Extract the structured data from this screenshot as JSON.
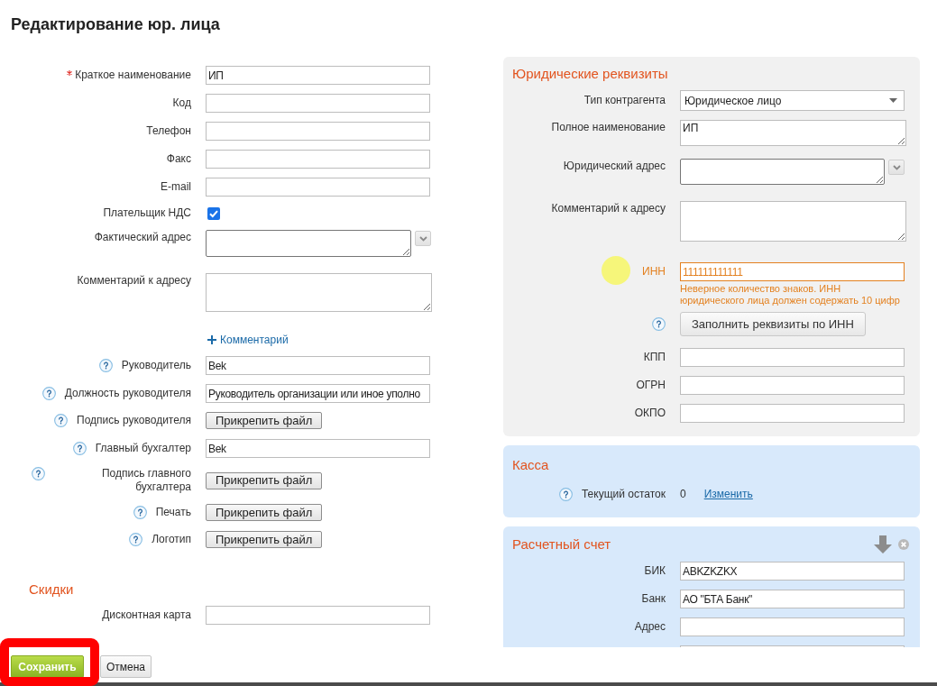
{
  "title": "Редактирование юр. лица",
  "main_form": {
    "rows": [
      {
        "label": "Краткое наименование",
        "kind": "input",
        "value": "ИП",
        "required": true,
        "help": false
      },
      {
        "label": "Код",
        "kind": "input",
        "required": false,
        "help": false
      },
      {
        "label": "Телефон",
        "kind": "input",
        "required": false,
        "help": false
      },
      {
        "label": "Факс",
        "kind": "input",
        "required": false,
        "help": false
      },
      {
        "label": "E-mail",
        "kind": "input",
        "required": false,
        "help": false
      },
      {
        "label": "Плательщик НДС",
        "kind": "checkbox",
        "checked": true,
        "required": false,
        "help": false
      },
      {
        "label": "Фактический адрес",
        "kind": "address",
        "required": false,
        "help": false
      },
      {
        "label": "Комментарий к адресу",
        "kind": "textarea",
        "required": false,
        "help": false
      },
      {
        "kind": "link",
        "text": "Комментарий"
      },
      {
        "label": "Руководитель",
        "kind": "input",
        "value": "Bek",
        "required": false,
        "help": true
      },
      {
        "label": "Должность руководителя",
        "kind": "input",
        "value": "Руководитель организации или иное уполно",
        "required": false,
        "help": true
      },
      {
        "label": "Подпись руководителя",
        "kind": "file",
        "button": "Прикрепить файл",
        "required": false,
        "help": true
      },
      {
        "label": "Главный бухгалтер",
        "kind": "input",
        "value": "Bek",
        "required": false,
        "help": true
      },
      {
        "label": "Подпись главного бухгалтера",
        "kind": "file",
        "button": "Прикрепить файл",
        "required": false,
        "help": true
      },
      {
        "label": "Печать",
        "kind": "file",
        "button": "Прикрепить файл",
        "required": false,
        "help": true
      },
      {
        "label": "Логотип",
        "kind": "file",
        "button": "Прикрепить файл",
        "required": false,
        "help": true
      }
    ]
  },
  "discounts": {
    "title": "Скидки",
    "rows": [
      {
        "label": "Дисконтная карта",
        "kind": "input",
        "required": false,
        "help": false
      }
    ]
  },
  "legal_details": {
    "title": "Юридические реквизиты",
    "rows": [
      {
        "label": "Тип контрагента",
        "kind": "select",
        "value": "Юридическое лицо",
        "invalid": false
      },
      {
        "label": "Полное наименование",
        "kind": "memo",
        "value": "ИП",
        "invalid": false
      },
      {
        "label": "Юридический адрес",
        "kind": "address",
        "invalid": false
      },
      {
        "label": "Комментарий к адресу",
        "kind": "textarea",
        "invalid": false
      },
      {
        "label": "ИНН",
        "kind": "input",
        "value": "111111111111",
        "invalid": true,
        "error": "Неверное количество знаков. ИНН юридического лица должен содержать 10 цифр"
      },
      {
        "kind": "action",
        "button": "Заполнить реквизиты по ИНН",
        "help": true
      },
      {
        "label": "КПП",
        "kind": "input",
        "invalid": false
      },
      {
        "label": "ОГРН",
        "kind": "input",
        "invalid": false
      },
      {
        "label": "ОКПО",
        "kind": "input",
        "invalid": false
      }
    ]
  },
  "cash": {
    "title": "Касса",
    "help": true,
    "label": "Текущий остаток",
    "value": "0",
    "link": "Изменить"
  },
  "bank_account": {
    "title": "Расчетный счет",
    "rows": [
      {
        "label": "БИК",
        "kind": "input",
        "value": "ABKZKZKX"
      },
      {
        "label": "Банк",
        "kind": "input",
        "value": "АО \"БТА Банк\""
      },
      {
        "label": "Адрес",
        "kind": "input"
      },
      {
        "kind": "input"
      }
    ]
  },
  "buttons": [
    {
      "label": "Сохранить",
      "kind": "primary"
    },
    {
      "label": "Отмена",
      "kind": "secondary"
    }
  ]
}
